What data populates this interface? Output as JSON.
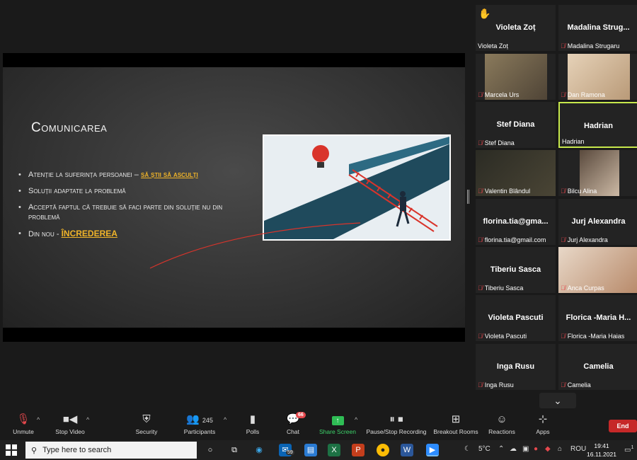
{
  "slide": {
    "title": "Comunicarea",
    "bullets": [
      {
        "text": "Atenție la suferința persoanei – ",
        "highlight": "să știi să asculți"
      },
      {
        "text": "Soluții adaptate la problemă",
        "highlight": ""
      },
      {
        "text": "Acceptă faptul că trebuie să faci parte din soluție nu din problemă",
        "highlight": ""
      },
      {
        "text": "Din nou - ",
        "highlight": "ÎNCREDEREA"
      }
    ]
  },
  "participants": [
    {
      "big_name": "Violeta Zoț",
      "label": "Violeta Zoț",
      "muted": false,
      "hand": true,
      "video": false
    },
    {
      "big_name": "Madalina  Strug...",
      "label": "Madalina Strugaru",
      "muted": true,
      "hand": false,
      "video": false
    },
    {
      "big_name": "",
      "label": "Marcela Urs",
      "muted": true,
      "hand": false,
      "video": true
    },
    {
      "big_name": "",
      "label": "Dan Ramona",
      "muted": true,
      "hand": false,
      "video": true
    },
    {
      "big_name": "Stef Diana",
      "label": "Stef Diana",
      "muted": true,
      "hand": false,
      "video": false
    },
    {
      "big_name": "Hadrian",
      "label": "Hadrian",
      "muted": false,
      "hand": false,
      "video": false,
      "active": true
    },
    {
      "big_name": "",
      "label": "Valentin Blândul",
      "muted": true,
      "hand": false,
      "video": true
    },
    {
      "big_name": "",
      "label": "Bilcu Alina",
      "muted": true,
      "hand": false,
      "video": true
    },
    {
      "big_name": "florina.tia@gma...",
      "label": "florina.tia@gmail.com",
      "muted": true,
      "hand": false,
      "video": false
    },
    {
      "big_name": "Jurj Alexandra",
      "label": "Jurj Alexandra",
      "muted": true,
      "hand": false,
      "video": false
    },
    {
      "big_name": "Tiberiu Sasca",
      "label": "Tiberiu Sasca",
      "muted": true,
      "hand": false,
      "video": false
    },
    {
      "big_name": "",
      "label": "Anca Curpas",
      "muted": true,
      "hand": false,
      "video": true
    },
    {
      "big_name": "Violeta Pascuti",
      "label": "Violeta Pascuti",
      "muted": true,
      "hand": false,
      "video": false
    },
    {
      "big_name": "Florica  -Maria  H...",
      "label": "Florica -Maria Haias",
      "muted": true,
      "hand": false,
      "video": false
    },
    {
      "big_name": "Inga Rusu",
      "label": "Inga Rusu",
      "muted": true,
      "hand": false,
      "video": false
    },
    {
      "big_name": "Camelia",
      "label": "Camelia",
      "muted": true,
      "hand": false,
      "video": false
    }
  ],
  "toolbar": {
    "unmute": "Unmute",
    "stop_video": "Stop Video",
    "security": "Security",
    "participants": "Participants",
    "participants_count": "245",
    "polls": "Polls",
    "chat": "Chat",
    "chat_badge": "66",
    "share_screen": "Share Screen",
    "recording": "Pause/Stop Recording",
    "breakout": "Breakout Rooms",
    "reactions": "Reactions",
    "apps": "Apps",
    "end": "End"
  },
  "taskbar": {
    "search_placeholder": "Type here to search",
    "mail_badge": "59",
    "temperature": "5°C",
    "language": "ROU",
    "time": "19:41",
    "date": "16.11.2021",
    "notification_count": "1"
  },
  "colors": {
    "accent_gold": "#f0b429",
    "active_speaker": "#c7e84c",
    "end_red": "#c62828",
    "share_green": "#2fbd55"
  }
}
